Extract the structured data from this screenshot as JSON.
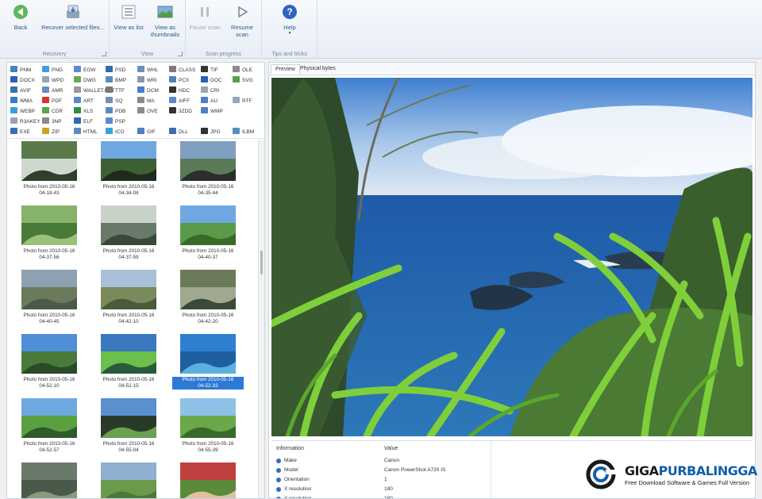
{
  "ribbon": {
    "groups": [
      {
        "label": "Recovery"
      },
      {
        "label": "View"
      },
      {
        "label": "Scan progress"
      },
      {
        "label": "Tips and tricks"
      }
    ],
    "buttons": {
      "back": "Back",
      "recover": "Recover selected files...",
      "view_list": "View as list",
      "view_thumbs": "View as thumbnails",
      "pause": "Pause scan",
      "resume": "Resume scan",
      "help": "Help"
    }
  },
  "file_types": [
    {
      "label": "PNM",
      "color": "#4a7fc1"
    },
    {
      "label": "PNG",
      "color": "#3aa0d8"
    },
    {
      "label": "EGW",
      "color": "#5b8bd0"
    },
    {
      "label": "PSD",
      "color": "#2e6ab0"
    },
    {
      "label": "WHL",
      "color": "#6d8fb8"
    },
    {
      "label": "CLASS",
      "color": "#7a7a7a"
    },
    {
      "label": "TIF",
      "color": "#333333"
    },
    {
      "label": "OLE",
      "color": "#8a8a8a"
    },
    {
      "label": "DOCX",
      "color": "#2b5fb5"
    },
    {
      "label": "WPD",
      "color": "#9aa5b4"
    },
    {
      "label": "DWG",
      "color": "#6aa84f"
    },
    {
      "label": "BMP",
      "color": "#5a8ac6"
    },
    {
      "label": "WRI",
      "color": "#8b98aa"
    },
    {
      "label": "PCX",
      "color": "#4f7fbf"
    },
    {
      "label": "DOC",
      "color": "#2b5fb5"
    },
    {
      "label": "SVG",
      "color": "#55a04a"
    },
    {
      "label": "AVIF",
      "color": "#3c6fb0"
    },
    {
      "label": "AMR",
      "color": "#6a8fc2"
    },
    {
      "label": "WALLET.DAT",
      "color": "#999999"
    },
    {
      "label": "TTF",
      "color": "#777777"
    },
    {
      "label": "DCM",
      "color": "#4a7fc1"
    },
    {
      "label": "HDC",
      "color": "#333333"
    },
    {
      "label": "CRI",
      "color": "#9aa5b4"
    },
    {
      "label": "WMA",
      "color": "#3a78c9"
    },
    {
      "label": "PDF",
      "color": "#d9342b"
    },
    {
      "label": "ART",
      "color": "#5a8ac6"
    },
    {
      "label": "SQ",
      "color": "#6f8fb5"
    },
    {
      "label": "MA",
      "color": "#8a8a8a"
    },
    {
      "label": "AIFF",
      "color": "#5a8ac6"
    },
    {
      "label": "AU",
      "color": "#4a7fc1"
    },
    {
      "label": "RTF",
      "color": "#9aa5b4"
    },
    {
      "label": "WEBP",
      "color": "#3aa0d8"
    },
    {
      "label": "CDR",
      "color": "#58a845"
    },
    {
      "label": "XLS",
      "color": "#2f8f46"
    },
    {
      "label": "PDB",
      "color": "#5a8ac6"
    },
    {
      "label": "OVE",
      "color": "#8a8a8a"
    },
    {
      "label": "3ZDD",
      "color": "#333333"
    },
    {
      "label": "WMP",
      "color": "#4f7fbf"
    },
    {
      "label": "R3AKEY",
      "color": "#9aa5b4"
    },
    {
      "label": "3NP",
      "color": "#8a8a8a"
    },
    {
      "label": "ELF",
      "color": "#2e6ab0"
    },
    {
      "label": "PSP",
      "color": "#5b8bd0"
    },
    {
      "label": "EXE",
      "color": "#3c6fb0"
    },
    {
      "label": "ZIP",
      "color": "#c9a227"
    },
    {
      "label": "HTML",
      "color": "#5a8ac6"
    },
    {
      "label": "ICO",
      "color": "#3aa0d8"
    },
    {
      "label": "GIF",
      "color": "#4a7fc1"
    },
    {
      "label": "DLL",
      "color": "#3c6fb0"
    },
    {
      "label": "JPG",
      "color": "#333333"
    },
    {
      "label": "ILBM",
      "color": "#5a8ac6"
    }
  ],
  "thumbnails": [
    {
      "line1": "Photo from 2010-05-16",
      "line2": "04-18-43"
    },
    {
      "line1": "Photo from 2010-05-16",
      "line2": "04-34-08"
    },
    {
      "line1": "Photo from 2010-05-16",
      "line2": "04-35-44"
    },
    {
      "line1": "Photo from 2010-05-16",
      "line2": "04-37-56"
    },
    {
      "line1": "Photo from 2010-05-16",
      "line2": "04-37-59"
    },
    {
      "line1": "Photo from 2010-05-16",
      "line2": "04-40-37"
    },
    {
      "line1": "Photo from 2010-05-16",
      "line2": "04-40-45"
    },
    {
      "line1": "Photo from 2010-05-16",
      "line2": "04-42-10"
    },
    {
      "line1": "Photo from 2010-05-16",
      "line2": "04-42-20"
    },
    {
      "line1": "Photo from 2010-05-16",
      "line2": "04-52-10"
    },
    {
      "line1": "Photo from 2010-05-16",
      "line2": "04-52-15"
    },
    {
      "line1": "Photo from 2010-05-16",
      "line2": "04-52-33"
    },
    {
      "line1": "Photo from 2010-05-16",
      "line2": "04-52-57"
    },
    {
      "line1": "Photo from 2010-05-16",
      "line2": "04-55-04"
    },
    {
      "line1": "Photo from 2010-05-16",
      "line2": "04-55-39"
    },
    {
      "line1": "",
      "line2": ""
    },
    {
      "line1": "",
      "line2": ""
    },
    {
      "line1": "",
      "line2": ""
    }
  ],
  "selected_thumbnail": 11,
  "tabs": {
    "preview": "Preview",
    "physical": "Physical bytes"
  },
  "info": {
    "col_information": "Information",
    "col_value": "Value",
    "rows": [
      {
        "name": "Make",
        "value": "Canon"
      },
      {
        "name": "Model",
        "value": "Canon PowerShot A720 IS"
      },
      {
        "name": "Orientation",
        "value": "1"
      },
      {
        "name": "X resolution",
        "value": "180"
      },
      {
        "name": "Y resolution",
        "value": "180"
      }
    ]
  },
  "watermark": {
    "brand_a": "GIGA",
    "brand_b": "PURBALINGGA",
    "tagline": "Free Download Software & Games Full Version"
  },
  "colors": {
    "accent": "#2c79d6",
    "ribbon_text": "#2a5a8a"
  }
}
